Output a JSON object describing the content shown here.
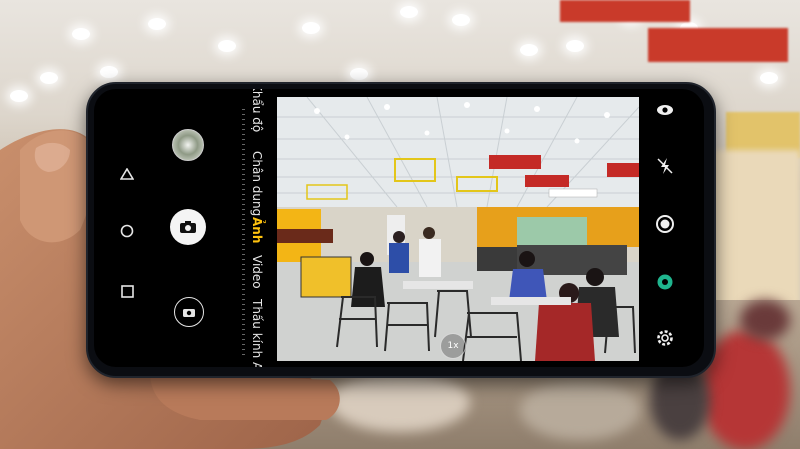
{
  "camera_app": {
    "modes": [
      "Khẩu độ",
      "Chân dung",
      "Ảnh",
      "Video",
      "Thấu kính AI"
    ],
    "active_mode": "Ảnh",
    "zoom_label": "1x"
  },
  "icons": {
    "nav": [
      "back-triangle-icon",
      "home-circle-icon",
      "recents-square-icon"
    ],
    "camera_left": [
      "gallery-thumbnail",
      "shutter-button",
      "switch-camera-icon"
    ],
    "camera_right": [
      "eye-icon",
      "flash-off-icon",
      "hdr-ring-icon",
      "filter-icon",
      "settings-gear-icon"
    ]
  },
  "colors": {
    "active_mode": "#ffc20e",
    "phone_body": "#0b0d12",
    "store_signage": "#c93a2a"
  }
}
